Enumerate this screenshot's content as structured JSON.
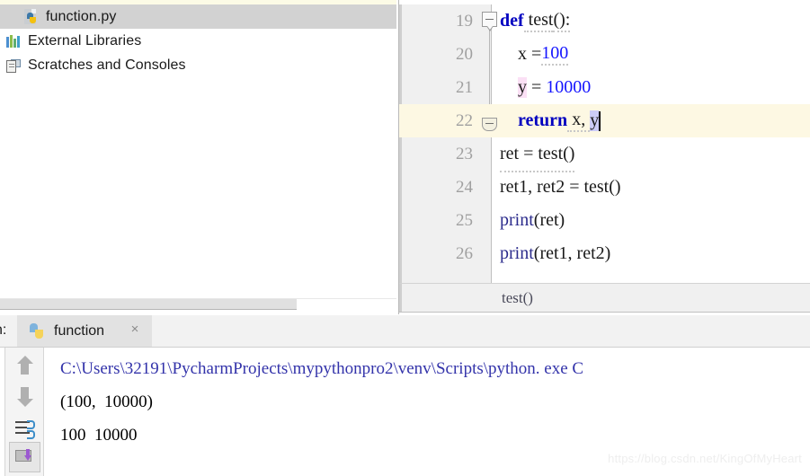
{
  "project_panel": {
    "items": [
      {
        "label": "function.py",
        "icon": "python-file-icon",
        "selected": true,
        "indent": 1
      },
      {
        "label": "External Libraries",
        "icon": "external-libraries-icon",
        "selected": false,
        "indent": 0
      },
      {
        "label": "Scratches and Consoles",
        "icon": "scratches-icon",
        "selected": false,
        "indent": 0
      }
    ]
  },
  "editor": {
    "lines": [
      {
        "number": "19",
        "text": "def test():"
      },
      {
        "number": "20",
        "text": "    x =100"
      },
      {
        "number": "21",
        "text": "    y = 10000"
      },
      {
        "number": "22",
        "text": "    return x, y",
        "current": true
      },
      {
        "number": "23",
        "text": "ret = test()"
      },
      {
        "number": "24",
        "text": "ret1, ret2 = test()"
      },
      {
        "number": "25",
        "text": "print(ret)"
      },
      {
        "number": "26",
        "text": "print(ret1, ret2)"
      }
    ],
    "tokens": {
      "kw_def": "def",
      "fn_test": " test",
      "paren_colon": "():",
      "l20_var": "    x =",
      "l20_num": "100",
      "l21_indent": "    ",
      "l21_var": "y",
      "l21_eq": " = ",
      "l21_num": "10000",
      "l22_indent": "    ",
      "l22_kw": "return",
      "l22_rest": " x, ",
      "l22_y": "y",
      "l23": "ret = test()",
      "l24": "ret1, ret2 = test()",
      "l25_fn": "print",
      "l25_args": "(ret)",
      "l26_fn": "print",
      "l26_args": "(ret1, ret2)"
    },
    "breadcrumb": "test()",
    "current_line_color": "#fdf8e3",
    "keyword_color": "#0000c0",
    "number_color": "#1414ff"
  },
  "run_panel": {
    "title": "n:",
    "tab_label": "function",
    "tab_close": "×",
    "toolbar": [
      {
        "name": "scroll-up-button"
      },
      {
        "name": "scroll-down-button"
      },
      {
        "name": "soft-wrap-button"
      },
      {
        "name": "print-button"
      }
    ],
    "console_lines": [
      {
        "text": "C:\\Users\\32191\\PycharmProjects\\mypythonpro2\\venv\\Scripts\\python. exe C",
        "kind": "path"
      },
      {
        "text": "(100,  10000)",
        "kind": "output"
      },
      {
        "text": "100  10000",
        "kind": "output"
      }
    ]
  },
  "watermark": "https://blog.csdn.net/KingOfMyHeart"
}
